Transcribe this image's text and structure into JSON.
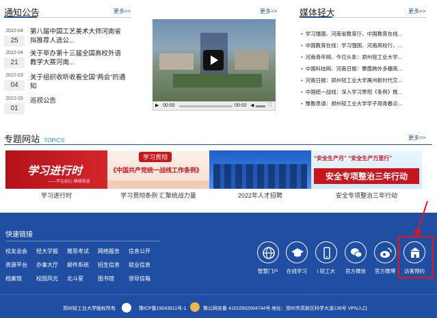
{
  "notice": {
    "title": "通知公告",
    "more": "更多>>",
    "items": [
      {
        "ym": "2022-04",
        "d": "25",
        "text": "第八届中国工艺美术大师河南省拟推荐人选公..."
      },
      {
        "ym": "2022-04",
        "d": "21",
        "text": "关于举办第十三届全国高校外语教学大赛河南..."
      },
      {
        "ym": "2022-03",
        "d": "04",
        "text": "关于组织收听收看全国“两会”的通知"
      },
      {
        "ym": "2022-03",
        "d": "01",
        "text": "巡视公告"
      }
    ]
  },
  "video": {
    "more": "更多>>",
    "time_current": "00:00",
    "time_total": "00:00"
  },
  "media": {
    "title": "媒体轻大",
    "more": "更多>>",
    "items": [
      "学习强国、河南省教育厅、中国教育在线...",
      "中国教育在线：学习强国、河南高校行、...",
      "河南青年网、今日头条：郑州轻工业大学...",
      "中国科技网、河南日报：蕈菌跨外多穗高...",
      "河南日报：郑州轻工业大学属州新时代交...",
      "中国统一战线：深入学习贯彻《条例》推...",
      "豫教思语：郑州轻工业大学学子用青春点..."
    ]
  },
  "topics": {
    "title": "专题网站",
    "title_en": "TOPICS",
    "more": "更多>>",
    "banners": [
      {
        "caption": "学习进行时",
        "text_main": "学习进行时",
        "text_sub": "——不忘初心 继续前进"
      },
      {
        "caption": "学习贯彻条例 汇聚统战力量",
        "text_top": "学习贯彻",
        "text_main": "《中国共产党统一战线工作条例》"
      },
      {
        "caption": "2022年人才招聘",
        "text_main": ""
      },
      {
        "caption": "安全专项整治三年行动",
        "text_top": "“安全生产月” “安全生产万里行”",
        "text_main": "安全专项整治三年行动"
      }
    ]
  },
  "footer": {
    "quick_title": "快速链接",
    "links_row1": [
      "校友总会",
      "轻大学报",
      "雅思考试",
      "网络服务",
      "信息公开"
    ],
    "links_row2": [
      "资源平台",
      "办事大厅",
      "邮件系统",
      "招生信息",
      "就业信息"
    ],
    "links_row3": [
      "档案馆",
      "校园风光",
      "北斗星",
      "图书馆",
      "领导信箱"
    ],
    "services": [
      {
        "label": "智慧门户",
        "icon": "globe-icon"
      },
      {
        "label": "在线学习",
        "icon": "graduation-cap-icon"
      },
      {
        "label": "i 轻工大",
        "icon": "phone-icon"
      },
      {
        "label": "官方微信",
        "icon": "wechat-icon"
      },
      {
        "label": "官方微博",
        "icon": "weibo-icon"
      },
      {
        "label": "访客预约",
        "icon": "building-icon"
      }
    ],
    "copyright": "郑州轻工业大学版权所有",
    "icp": "豫ICP备19043611号-1",
    "police": "豫公网安备 41010502004744号",
    "address": "地址：郑州市高新区科学大道136号 VPN入口"
  },
  "colors": {
    "brand": "#1f4ea2",
    "accent_red": "#c8161d",
    "teal": "#13a0a0"
  }
}
